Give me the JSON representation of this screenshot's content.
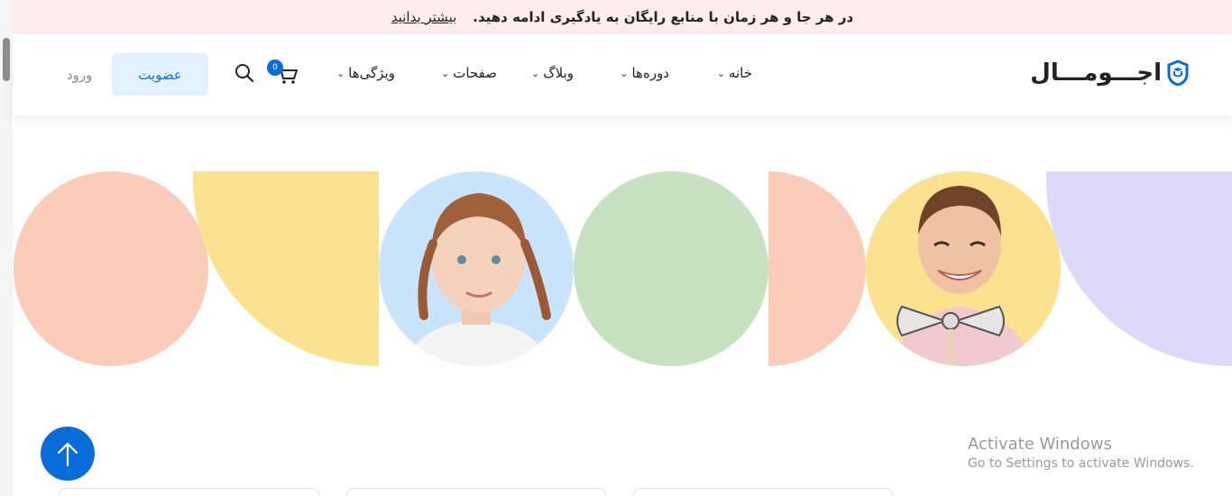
{
  "announcement": {
    "message": "در هر جا و هر زمان با منابع رایگان به یادگیری ادامه دهید.",
    "link": "بیشتر بدانید"
  },
  "header": {
    "logo_text": "اجـــومـــال",
    "nav": [
      {
        "label": "خانه"
      },
      {
        "label": "دوره‌ها"
      },
      {
        "label": "وبلاگ"
      },
      {
        "label": "صفحات"
      },
      {
        "label": "ویژگی‌ها"
      }
    ],
    "cart_count": "0",
    "join_label": "عضویت",
    "login_label": "ورود"
  },
  "hero": {
    "images": [
      "girl-with-braids-photo",
      "boy-with-bowtie-prop-photo"
    ],
    "colors": {
      "peach": "#fcccba",
      "yellow": "#fce191",
      "blue": "#c9e4fb",
      "green": "#c6e2c1",
      "lavender": "#ded8f9"
    }
  },
  "watermark": {
    "title": "Activate Windows",
    "subtitle": "Go to Settings to activate Windows."
  },
  "colors": {
    "brand": "#0a6cd8",
    "topbar_bg": "#fdeeed",
    "join_bg": "#e3f1fd"
  }
}
